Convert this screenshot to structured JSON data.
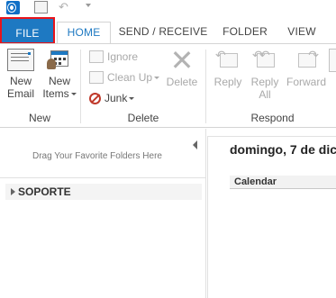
{
  "quick_access": {
    "app_icon": "outlook-icon",
    "send_receive_icon": "send-receive-all-icon",
    "undo_icon": "undo-icon",
    "undo_glyph": "↶",
    "customize_icon": "chevron-down-icon"
  },
  "tabs": [
    {
      "label": "FILE",
      "active": false
    },
    {
      "label": "HOME",
      "active": true
    },
    {
      "label": "SEND / RECEIVE",
      "active": false
    },
    {
      "label": "FOLDER",
      "active": false
    },
    {
      "label": "VIEW",
      "active": false
    }
  ],
  "ribbon": {
    "new_group": {
      "label": "New",
      "new_email_line1": "New",
      "new_email_line2": "Email",
      "new_items_line1": "New",
      "new_items_line2": "Items"
    },
    "delete_group": {
      "label": "Delete",
      "ignore": "Ignore",
      "clean_up": "Clean Up",
      "junk": "Junk",
      "delete": "Delete"
    },
    "respond_group": {
      "label": "Respond",
      "reply": "Reply",
      "reply_all_line1": "Reply",
      "reply_all_line2": "All",
      "forward": "Forward"
    }
  },
  "folder_pane": {
    "favorites_hint": "Drag Your Favorite Folders Here",
    "account": "SOPORTE"
  },
  "main": {
    "date_heading": "domingo, 7 de dic",
    "calendar_header": "Calendar"
  },
  "colors": {
    "file_tab": "#1e79c2",
    "highlight_box": "#e8141b"
  }
}
